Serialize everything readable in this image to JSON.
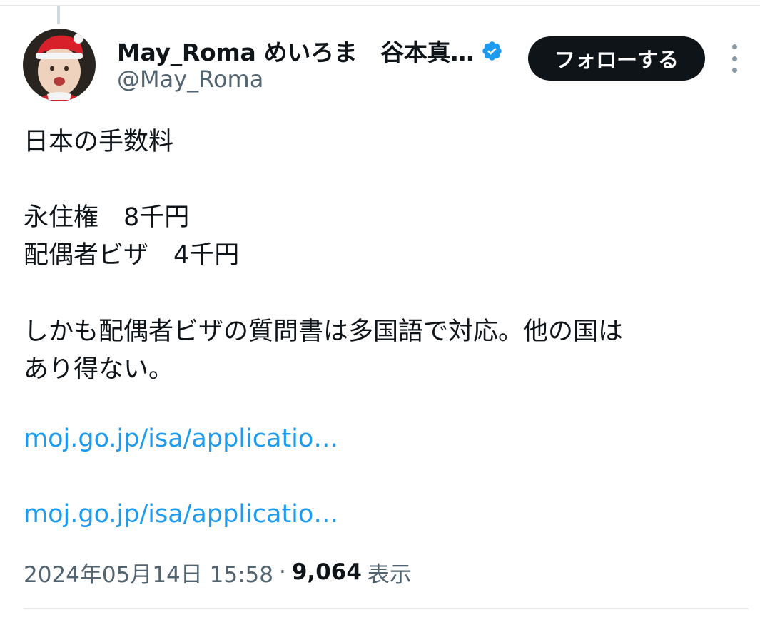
{
  "author": {
    "display_name": "May_Roma めいろま　谷本真…",
    "handle": "@May_Roma",
    "verified": true,
    "verified_color": "#1d9bf0"
  },
  "follow_button": {
    "label": "フォローする"
  },
  "more_menu": {
    "icon": "more-vertical-icon"
  },
  "tweet": {
    "lines": [
      "日本の手数料",
      "永住権　8千円",
      "配偶者ビザ　4千円",
      "しかも配偶者ビザの質問書は多国語で対応。他の国は",
      "あり得ない。"
    ],
    "links": [
      "moj.go.jp/isa/applicatio…",
      "moj.go.jp/isa/applicatio…"
    ]
  },
  "meta": {
    "timestamp": "2024年05月14日 15:58",
    "separator": "·",
    "views_count": "9,064",
    "views_label": "表示"
  },
  "colors": {
    "text": "#0f1419",
    "secondary": "#536471",
    "link": "#1d9bf0",
    "button_bg": "#0f1419"
  }
}
